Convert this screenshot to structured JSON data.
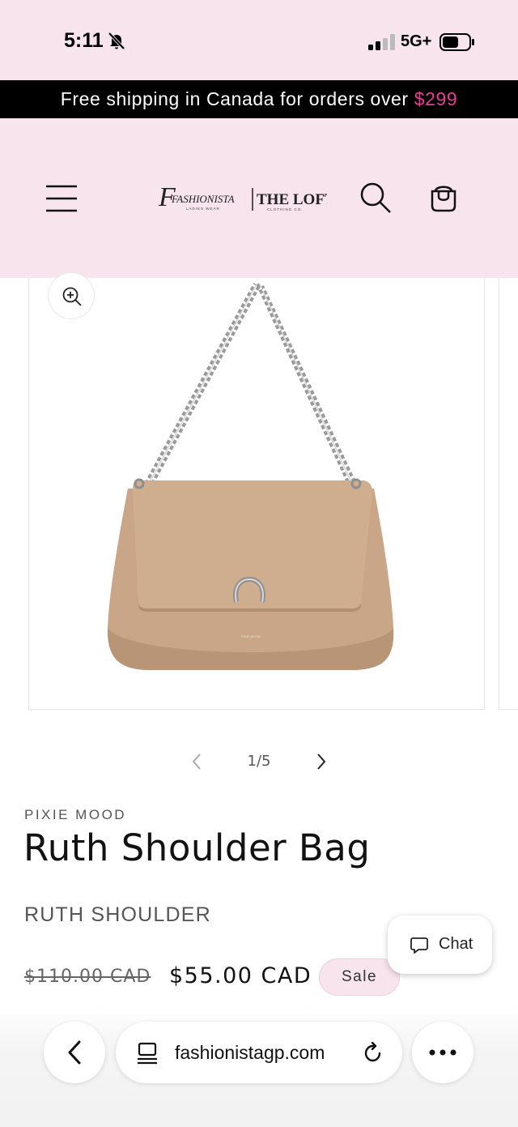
{
  "status_bar": {
    "time": "5:11",
    "network": "5G+",
    "icons": [
      "bell-muted-icon",
      "signal-icon",
      "battery-icon"
    ]
  },
  "announcement": {
    "text": "Free shipping in Canada for orders over ",
    "amount": "$299",
    "accent_color": "#e93c95"
  },
  "header": {
    "logo_text_left": "FASHIONISTA",
    "logo_sub_left": "LADIES WEAR",
    "logo_text_right": "THE LOFT",
    "logo_sub_right": "CLOTHING CO.",
    "icons": [
      "menu-icon",
      "search-icon",
      "cart-icon"
    ],
    "background": "#f8e4ec"
  },
  "gallery": {
    "counter": "1/5",
    "image_name": "tan shoulder bag with chain strap",
    "brand_stamp": "PIXIE MOOD"
  },
  "product": {
    "vendor": "PIXIE MOOD",
    "title": "Ruth Shoulder Bag",
    "subtitle": "RUTH SHOULDER",
    "price_regular": "$110.00 CAD",
    "price_sale": "$55.00 CAD",
    "badge": "Sale"
  },
  "chat": {
    "label": "Chat"
  },
  "browser": {
    "url": "fashionistagp.com",
    "icons": [
      "back-icon",
      "tab-icon",
      "reload-icon",
      "more-icon"
    ]
  }
}
